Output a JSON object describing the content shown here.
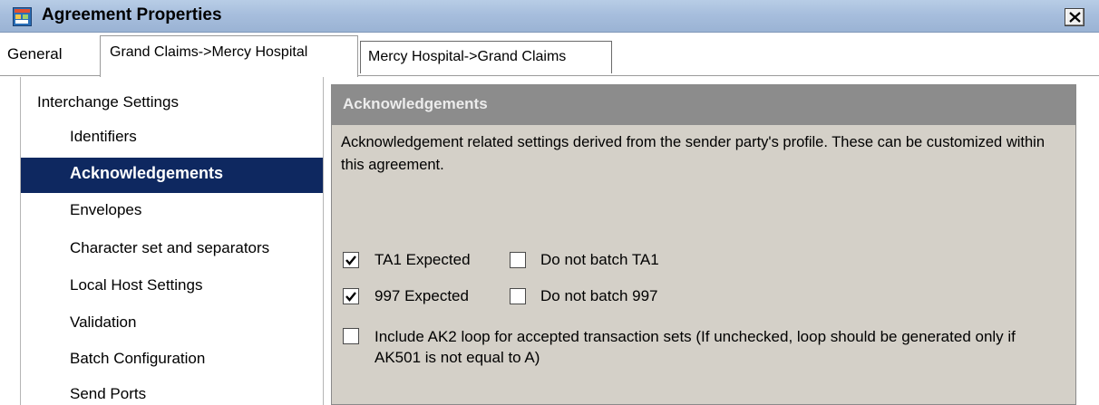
{
  "window": {
    "title": "Agreement Properties",
    "icon": "app-window-icon",
    "close_icon": "close-icon"
  },
  "tabs": [
    {
      "label": "General",
      "selected": false
    },
    {
      "label": "Grand Claims->Mercy Hospital",
      "selected": true
    },
    {
      "label": "Mercy Hospital->Grand Claims",
      "selected": false
    }
  ],
  "sidebar": {
    "root": "Interchange Settings",
    "items": [
      {
        "label": "Identifiers",
        "selected": false
      },
      {
        "label": "Acknowledgements",
        "selected": true
      },
      {
        "label": "Envelopes",
        "selected": false
      },
      {
        "label": "Character set and separators",
        "selected": false
      },
      {
        "label": "Local Host Settings",
        "selected": false
      },
      {
        "label": "Validation",
        "selected": false
      },
      {
        "label": "Batch Configuration",
        "selected": false
      },
      {
        "label": "Send Ports",
        "selected": false
      }
    ]
  },
  "panel": {
    "header": "Acknowledgements",
    "description": "Acknowledgement related settings derived from the sender party's profile. These can be customized within this agreement.",
    "checkboxes": {
      "ta1_expected": {
        "label": "TA1 Expected",
        "checked": true
      },
      "do_not_batch_ta1": {
        "label": "Do not batch TA1",
        "checked": false
      },
      "expected_997": {
        "label": "997 Expected",
        "checked": true
      },
      "do_not_batch_997": {
        "label": "Do not batch 997",
        "checked": false
      },
      "include_ak2": {
        "label": "Include AK2 loop for accepted transaction sets (If unchecked, loop should be generated only if AK501 is not equal to A)",
        "checked": false
      }
    }
  },
  "colors": {
    "selected_nav_bg": "#0e2860",
    "panel_bg": "#d4d0c8",
    "panel_header_bg": "#8c8c8c",
    "titlebar": "#a7bedd"
  }
}
